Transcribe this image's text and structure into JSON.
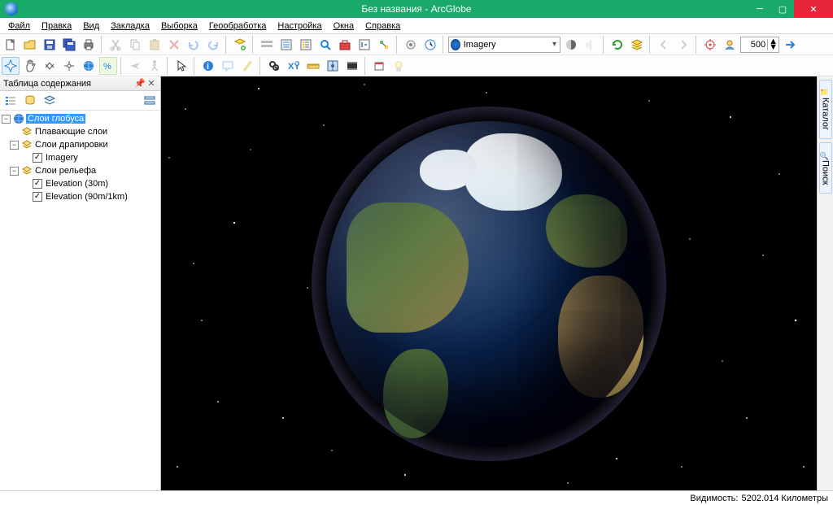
{
  "titlebar": {
    "title": "Без названия - ArcGlobe"
  },
  "menu": {
    "file": "Файл",
    "edit": "Правка",
    "view": "Вид",
    "bookmark": "Закладка",
    "select": "Выборка",
    "geoproc": "Геообработка",
    "custom": "Настройка",
    "window": "Окна",
    "help": "Справка"
  },
  "toolbar1": {
    "layer_combo": "Imagery",
    "scale_value": "500"
  },
  "toc": {
    "title": "Таблица содержания",
    "root": "Слои глобуса",
    "floating": "Плавающие слои",
    "draped": "Слои драпировки",
    "imagery": "Imagery",
    "elevation_group": "Слои рельефа",
    "elev30": "Elevation (30m)",
    "elev90": "Elevation (90m/1km)"
  },
  "rtabs": {
    "catalog": "Каталог",
    "search": "Поиск"
  },
  "status": {
    "vis_label": "Видимость:",
    "vis_value": "5202.014 Километры"
  }
}
